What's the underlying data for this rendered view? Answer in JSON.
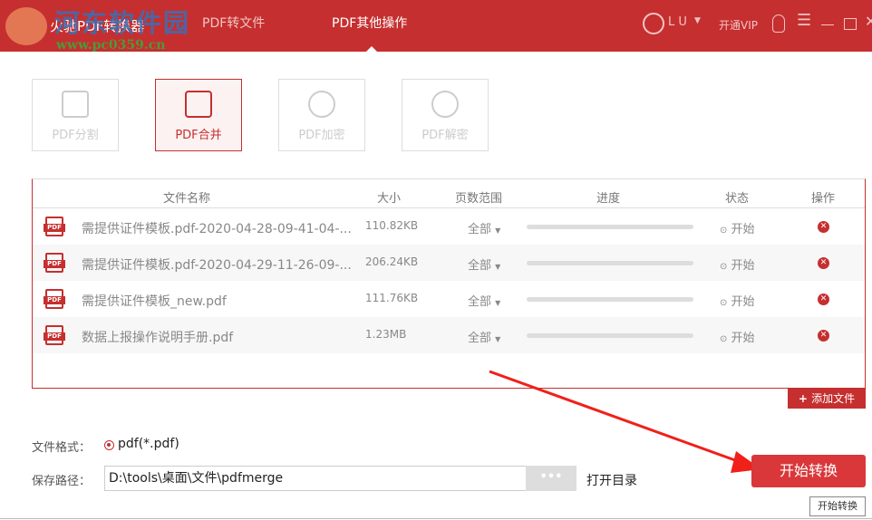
{
  "header": {
    "app_title": "火驰PDF转换器",
    "tabs": [
      "PDF转文件",
      "PDF其他操作"
    ],
    "active_tab": 1,
    "user": "L U",
    "vip": "开通VIP"
  },
  "watermark": {
    "name": "河东软件园",
    "url": "www.pc0359.cn"
  },
  "tools": [
    {
      "label": "PDF分割"
    },
    {
      "label": "PDF合并"
    },
    {
      "label": "PDF加密"
    },
    {
      "label": "PDF解密"
    }
  ],
  "table": {
    "headers": [
      "文件名称",
      "大小",
      "页数范围",
      "进度",
      "状态",
      "操作"
    ],
    "rows": [
      {
        "name": "需提供证件模板.pdf-2020-04-28-09-41-04-...",
        "size": "110.82KB",
        "range": "全部",
        "progress": 0,
        "status": "开始"
      },
      {
        "name": "需提供证件模板.pdf-2020-04-29-11-26-09-...",
        "size": "206.24KB",
        "range": "全部",
        "progress": 0,
        "status": "开始"
      },
      {
        "name": "需提供证件模板_new.pdf",
        "size": "111.76KB",
        "range": "全部",
        "progress": 0,
        "status": "开始"
      },
      {
        "name": "数据上报操作说明手册.pdf",
        "size": "1.23MB",
        "range": "全部",
        "progress": 0,
        "status": "开始"
      }
    ]
  },
  "add_file": "添加文件",
  "format": {
    "label": "文件格式：",
    "value": "pdf(*.pdf)"
  },
  "path": {
    "label": "保存路径：",
    "value": "D:\\tools\\桌面\\文件\\pdfmerge",
    "browse": "•••",
    "open_dir": "打开目录"
  },
  "start_button": "开始转换",
  "tooltip": "开始转换",
  "pdf_badge": "PDF",
  "colors": {
    "brand": "#c62f2f"
  }
}
